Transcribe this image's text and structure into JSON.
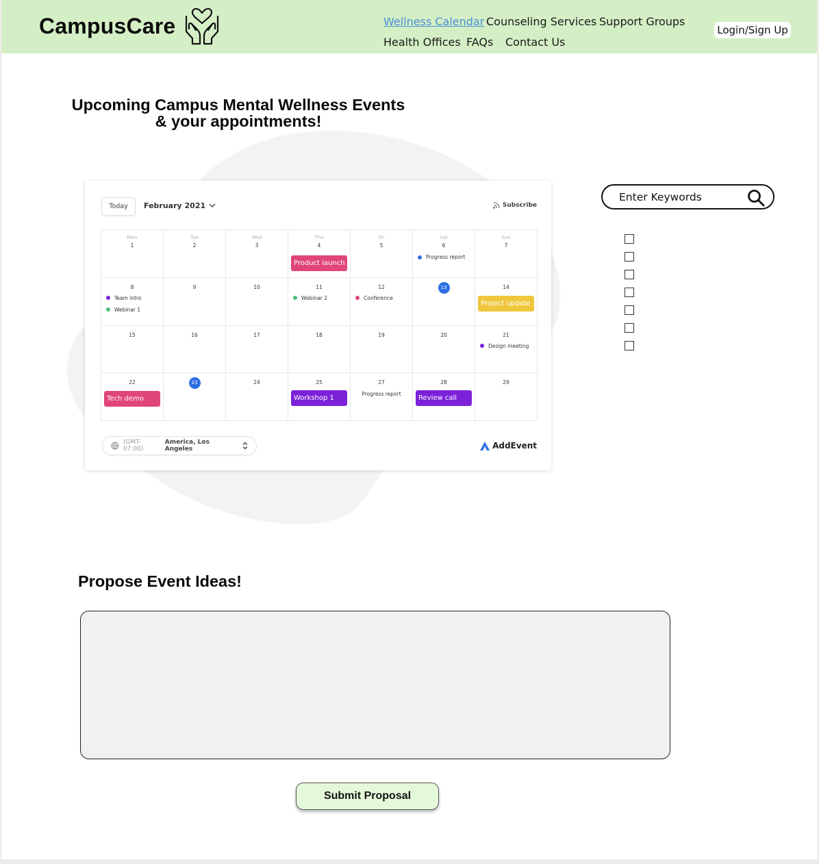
{
  "header": {
    "brand": "CampusCare",
    "logo_icon": "hands-heart-icon",
    "nav": [
      {
        "label": "Wellness Calendar",
        "active": true
      },
      {
        "label": "Counseling Services",
        "active": false
      },
      {
        "label": "Support Groups",
        "active": false
      },
      {
        "label": "Health Offices",
        "active": false
      },
      {
        "label": "FAQs",
        "active": false
      },
      {
        "label": "Contact Us",
        "active": false
      }
    ],
    "login_label": "Login/Sign Up"
  },
  "main": {
    "title_line1": "Upcoming Campus Mental Wellness Events",
    "title_line2": "& your appointments!"
  },
  "calendar": {
    "today_label": "Today",
    "month_label": "February 2021",
    "subscribe_label": "Subscribe",
    "weekdays": [
      "Mon",
      "Tue",
      "Wed",
      "Thu",
      "Fri",
      "Sat",
      "Sun"
    ],
    "weeks": [
      [
        "1",
        "2",
        "3",
        "4",
        "5",
        "6",
        "7"
      ],
      [
        "8",
        "9",
        "10",
        "11",
        "12",
        "13",
        "14"
      ],
      [
        "15",
        "16",
        "17",
        "18",
        "19",
        "20",
        "21"
      ],
      [
        "22",
        "23",
        "24",
        "25",
        "27",
        "28",
        "29"
      ]
    ],
    "highlighted_days": [
      "13",
      "23"
    ],
    "events": {
      "product_launch": "Product launch",
      "progress_report_sat": "Progress report",
      "team_intro": "Team intro",
      "webinar_1": "Webinar 1",
      "webinar_2": "Webinar 2",
      "conference": "Conference",
      "project_update": "Project update",
      "design_meeting": "Design meeting",
      "tech_demo": "Tech demo",
      "workshop_1": "Workshop 1",
      "progress_report_fri": "Progress report",
      "review_call": "Review call"
    },
    "timezone_offset": "(GMT-07:00)",
    "timezone_name": "America, Los Angeles",
    "provider": "AddEvent",
    "colors": {
      "pink": "#e0457b",
      "purple": "#7b22d9",
      "yellow": "#f0c73c",
      "blue": "#2d6fe3",
      "green": "#4cc17a"
    }
  },
  "search": {
    "placeholder": "Enter Keywords",
    "icon": "search-icon"
  },
  "filters": {
    "checkbox_count": 7
  },
  "propose": {
    "title": "Propose Event Ideas!",
    "textarea_value": "",
    "submit_label": "Submit Proposal"
  }
}
